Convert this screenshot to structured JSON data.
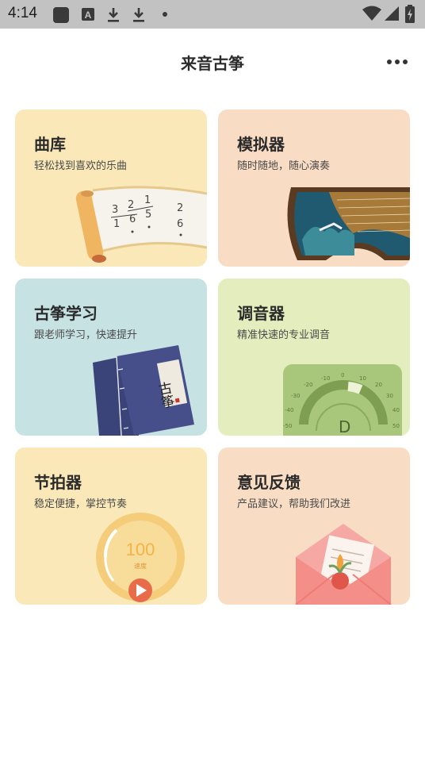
{
  "status_bar": {
    "time": "4:14",
    "icons": [
      "app-square-icon",
      "text-a-icon",
      "download-icon",
      "download-icon",
      "dot-icon",
      "wifi-icon",
      "signal-icon",
      "battery-charging-icon"
    ]
  },
  "header": {
    "title": "来音古筝",
    "more_icon": "more-horizontal-icon"
  },
  "cards": [
    {
      "title": "曲库",
      "subtitle": "轻松找到喜欢的乐曲",
      "color": "#fae8b8",
      "illustration": "music-scroll"
    },
    {
      "title": "模拟器",
      "subtitle": "随时随地，随心演奏",
      "color": "#f8dcc4",
      "illustration": "guzheng"
    },
    {
      "title": "古筝学习",
      "subtitle": "跟老师学习，快速提升",
      "color": "#c7e2e3",
      "illustration": "books"
    },
    {
      "title": "调音器",
      "subtitle": "精准快速的专业调音",
      "color": "#e3edbd",
      "illustration": "tuner-dial"
    },
    {
      "title": "节拍器",
      "subtitle": "稳定便捷，掌控节奏",
      "color": "#fae8b8",
      "illustration": "metronome"
    },
    {
      "title": "意见反馈",
      "subtitle": "产品建议，帮助我们改进",
      "color": "#f8dcc4",
      "illustration": "envelope"
    }
  ],
  "illustrations": {
    "scroll_numbers": [
      "3",
      "2",
      "1",
      "1",
      "6",
      "5",
      "2",
      "6"
    ],
    "book_title": "古筝",
    "tuner_note": "D",
    "tuner_scale": [
      "-50",
      "-40",
      "-30",
      "-20",
      "-10",
      "0",
      "10",
      "20",
      "30",
      "40",
      "50"
    ],
    "metronome_bpm": "100",
    "metronome_unit": "速度"
  }
}
